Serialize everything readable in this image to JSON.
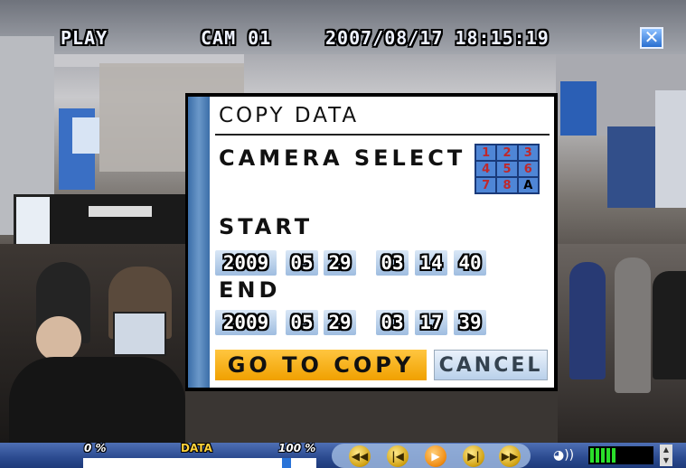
{
  "osd": {
    "mode": "PLAY",
    "camera": "CAM 01",
    "datetime": "2007/08/17 18:15:19",
    "close_icon": "close-icon"
  },
  "dialog": {
    "title": "COPY DATA",
    "camera_select_label": "CAMERA SELECT",
    "camera_grid": [
      "1",
      "2",
      "3",
      "4",
      "5",
      "6",
      "7",
      "8",
      "A"
    ],
    "start_label": "START",
    "start": {
      "year": "2009",
      "month": "05",
      "day": "29",
      "hour": "03",
      "minute": "14",
      "second": "40"
    },
    "end_label": "END",
    "end": {
      "year": "2009",
      "month": "05",
      "day": "29",
      "hour": "03",
      "minute": "17",
      "second": "39"
    },
    "go_to_copy_label": "GO TO COPY",
    "cancel_label": "CANCEL",
    "colors": {
      "stripe": "#3b6ea8",
      "go_button": "#f0a000",
      "cancel_button": "#b9d0ea"
    }
  },
  "bottom_bar": {
    "progress_min": "0 %",
    "data_label": "DATA",
    "progress_max": "100 %",
    "progress_value": 0.88,
    "controls": [
      "rewind-fast-icon",
      "step-back-icon",
      "play-icon",
      "step-forward-icon",
      "fast-forward-icon"
    ],
    "volume_level": 0.45,
    "volume_color": "#2adf2a"
  }
}
